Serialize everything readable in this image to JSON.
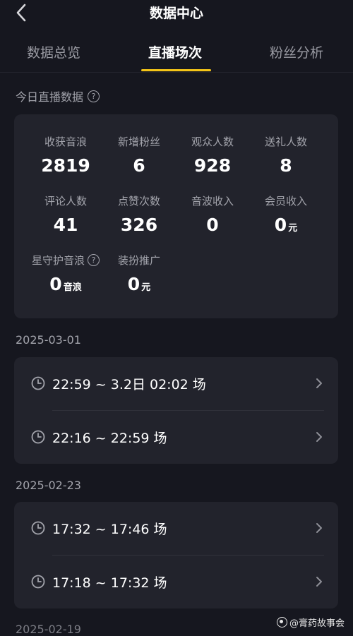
{
  "header": {
    "title": "数据中心"
  },
  "tabs": [
    {
      "label": "数据总览"
    },
    {
      "label": "直播场次",
      "active": true
    },
    {
      "label": "粉丝分析"
    }
  ],
  "today": {
    "label": "今日直播数据",
    "stats": [
      {
        "label": "收获音浪",
        "value": "2819",
        "unit": ""
      },
      {
        "label": "新增粉丝",
        "value": "6",
        "unit": ""
      },
      {
        "label": "观众人数",
        "value": "928",
        "unit": ""
      },
      {
        "label": "送礼人数",
        "value": "8",
        "unit": ""
      },
      {
        "label": "评论人数",
        "value": "41",
        "unit": ""
      },
      {
        "label": "点赞次数",
        "value": "326",
        "unit": ""
      },
      {
        "label": "音波收入",
        "value": "0",
        "unit": ""
      },
      {
        "label": "会员收入",
        "value": "0",
        "unit": "元"
      },
      {
        "label": "星守护音浪",
        "value": "0",
        "unit": "音浪"
      },
      {
        "label": "装扮推广",
        "value": "0",
        "unit": "元"
      }
    ]
  },
  "sessions": [
    {
      "date": "2025-03-01",
      "items": [
        {
          "time": "22:59 ~ 3.2日 02:02 场"
        },
        {
          "time": "22:16 ~ 22:59 场"
        }
      ]
    },
    {
      "date": "2025-02-23",
      "items": [
        {
          "time": "17:32 ~ 17:46 场"
        },
        {
          "time": "17:18 ~ 17:32 场"
        }
      ]
    }
  ],
  "partial_date": "2025-02-19",
  "watermark": "@膏药故事会",
  "colors": {
    "accent": "#f5c518",
    "background": "#16171f",
    "card": "#22232c"
  }
}
